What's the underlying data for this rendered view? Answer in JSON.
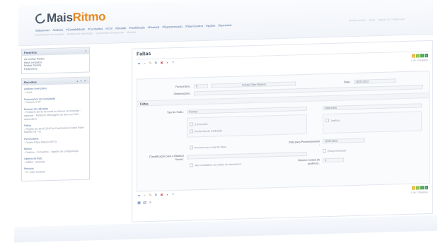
{
  "app": {
    "logo_prefix": "Mais",
    "logo_suffix": "Ritmo"
  },
  "main_menu": [
    "Subscrever",
    "Análises",
    "#Contabilidade",
    "#Controlitus",
    "#Crm",
    "#Gestão",
    "#Imobilizado",
    "#Pessoal",
    "#Supermercado",
    "#TeamControl",
    "Opções",
    "Supervisor"
  ],
  "sub_menu": [
    "Documentos de Inventário",
    "Modelos de Importação",
    "Documentos Temporários",
    "Modelos"
  ],
  "user_links": [
    "Sessão iniciada",
    "Ajuda",
    "Opções de configuração"
  ],
  "sidebar": {
    "favoritos": {
      "title": "Favoritos",
      "items": [
        "As minhas Pastas",
        "Meus contactos",
        "Minhas Tarefas",
        "Parâmetros"
      ]
    },
    "recentes": {
      "title": "Recentes",
      "items": [
        {
          "title": "Análises Avançadas",
          "sub": "- Users"
        },
        {
          "title": "Documentos de Facturação",
          "sub": "- Factura nº 87"
        },
        {
          "title": "Eventos de Utilizador",
          "sub": "- Relatório Envio de email ao efetuar encomenda - Agendar - Relatório Mensagem ao abrir um RAT - Automático"
        },
        {
          "title": "Faltas",
          "sub": "- Registo de 18.05.2012 do Funcionário Duarte Filipe Raposo (N.º 6)"
        },
        {
          "title": "Funcionários",
          "sub": "- Duarte Filipe Raposo (Nº 6)"
        },
        {
          "title": "Menus",
          "sub": "- Rubrica - Conselhos - Opções de configuração"
        },
        {
          "title": "Objetos de BizE",
          "sub": "- WEBS - Activado"
        },
        {
          "title": "Pessoas",
          "sub": "- Sr. João Santana"
        }
      ]
    }
  },
  "content": {
    "title": "Faltas",
    "page_info": "1 de 1 Registos",
    "form": {
      "funcionario_label": "Funcionário :",
      "funcionario_num": "6",
      "funcionario_name": "Duarte Filipe Raposo",
      "data_label": "Data :",
      "data_value": "18.05.2012",
      "observacoes_label": "Observações :",
      "faltas_section": "Faltas",
      "tipo_label": "Tipo de Falta :",
      "tipo_value": "Doença",
      "data_inicio_value": "Data Início",
      "chk_descontar": "É descontar",
      "chk_justifica": "Justifica",
      "chk_perda": "Perda total de retribuição",
      "chk_prevista": "Prevista com o total de faltas",
      "classificacao_label": "Classificação para o Balanço Social :",
      "data_processamento_label": "Data para Processamento :",
      "data_processamento_value": "18.05.2012",
      "chk_processado": "Está processado",
      "chk_contabilizar": "Não contabilizar na análise de absentismo",
      "numero_meses_label": "Número meses de ausência :",
      "numero_meses_value": "0"
    }
  }
}
